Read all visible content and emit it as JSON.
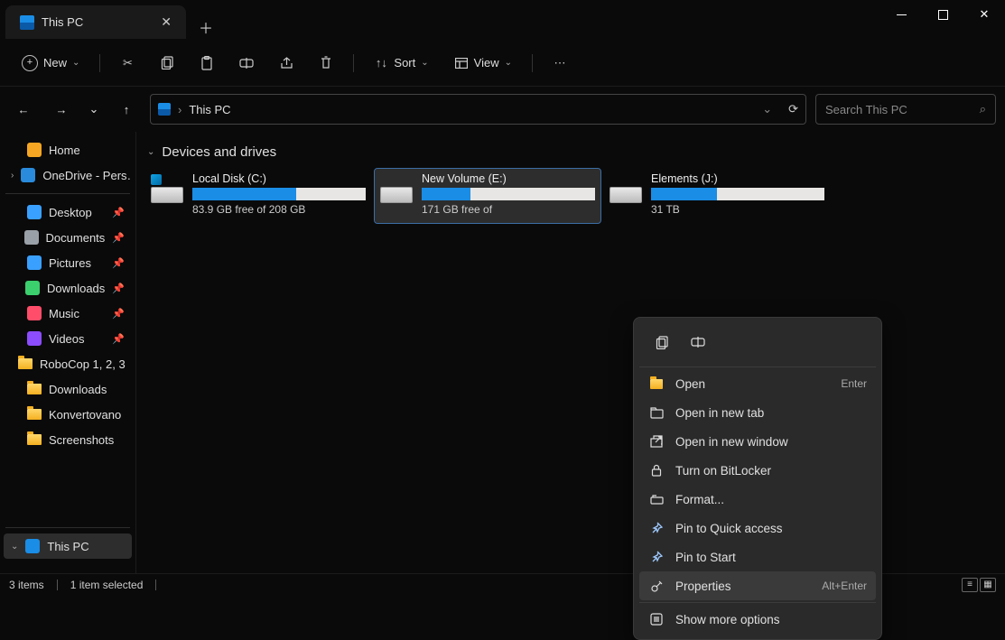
{
  "tab": {
    "icon": "this-pc-icon",
    "title": "This PC"
  },
  "toolbar": {
    "new_label": "New",
    "sort_label": "Sort",
    "view_label": "View"
  },
  "address": {
    "location": "This PC",
    "search_placeholder": "Search This PC"
  },
  "sidebar": {
    "top": [
      {
        "label": "Home",
        "icon": "home",
        "chev": false
      },
      {
        "label": "OneDrive - Pers…",
        "icon": "onedrive",
        "chev": true
      }
    ],
    "quick": [
      {
        "label": "Desktop",
        "icon": "desktop",
        "pinned": true
      },
      {
        "label": "Documents",
        "icon": "documents",
        "pinned": true
      },
      {
        "label": "Pictures",
        "icon": "pictures",
        "pinned": true
      },
      {
        "label": "Downloads",
        "icon": "downloads",
        "pinned": true
      },
      {
        "label": "Music",
        "icon": "music",
        "pinned": true
      },
      {
        "label": "Videos",
        "icon": "videos",
        "pinned": true
      },
      {
        "label": "RoboCop 1, 2, 3",
        "icon": "folder",
        "pinned": false
      },
      {
        "label": "Downloads",
        "icon": "folder",
        "pinned": false
      },
      {
        "label": "Konvertovano",
        "icon": "folder",
        "pinned": false
      },
      {
        "label": "Screenshots",
        "icon": "folder",
        "pinned": false
      }
    ],
    "bottom": [
      {
        "label": "This PC",
        "icon": "this-pc",
        "selected": true
      }
    ]
  },
  "group": {
    "header": "Devices and drives"
  },
  "drives": [
    {
      "name": "Local Disk (C:)",
      "free": "83.9 GB free of 208 GB",
      "pct": 60,
      "win": true,
      "selected": false
    },
    {
      "name": "New Volume (E:)",
      "free": "171 GB free of",
      "pct": 28,
      "win": false,
      "selected": true
    },
    {
      "name": "Elements (J:)",
      "free": "31 TB",
      "pct": 38,
      "win": false,
      "selected": false
    }
  ],
  "context": {
    "items": [
      {
        "label": "Open",
        "shortcut": "Enter",
        "icon": "open"
      },
      {
        "label": "Open in new tab",
        "shortcut": "",
        "icon": "newtab"
      },
      {
        "label": "Open in new window",
        "shortcut": "",
        "icon": "newwin"
      },
      {
        "label": "Turn on BitLocker",
        "shortcut": "",
        "icon": "lock"
      },
      {
        "label": "Format...",
        "shortcut": "",
        "icon": "format"
      },
      {
        "label": "Pin to Quick access",
        "shortcut": "",
        "icon": "pin"
      },
      {
        "label": "Pin to Start",
        "shortcut": "",
        "icon": "pin"
      },
      {
        "label": "Properties",
        "shortcut": "Alt+Enter",
        "icon": "props",
        "hover": true
      },
      {
        "label": "Show more options",
        "shortcut": "",
        "icon": "more",
        "sep_before": true
      }
    ]
  },
  "status": {
    "count": "3 items",
    "selected": "1 item selected"
  }
}
